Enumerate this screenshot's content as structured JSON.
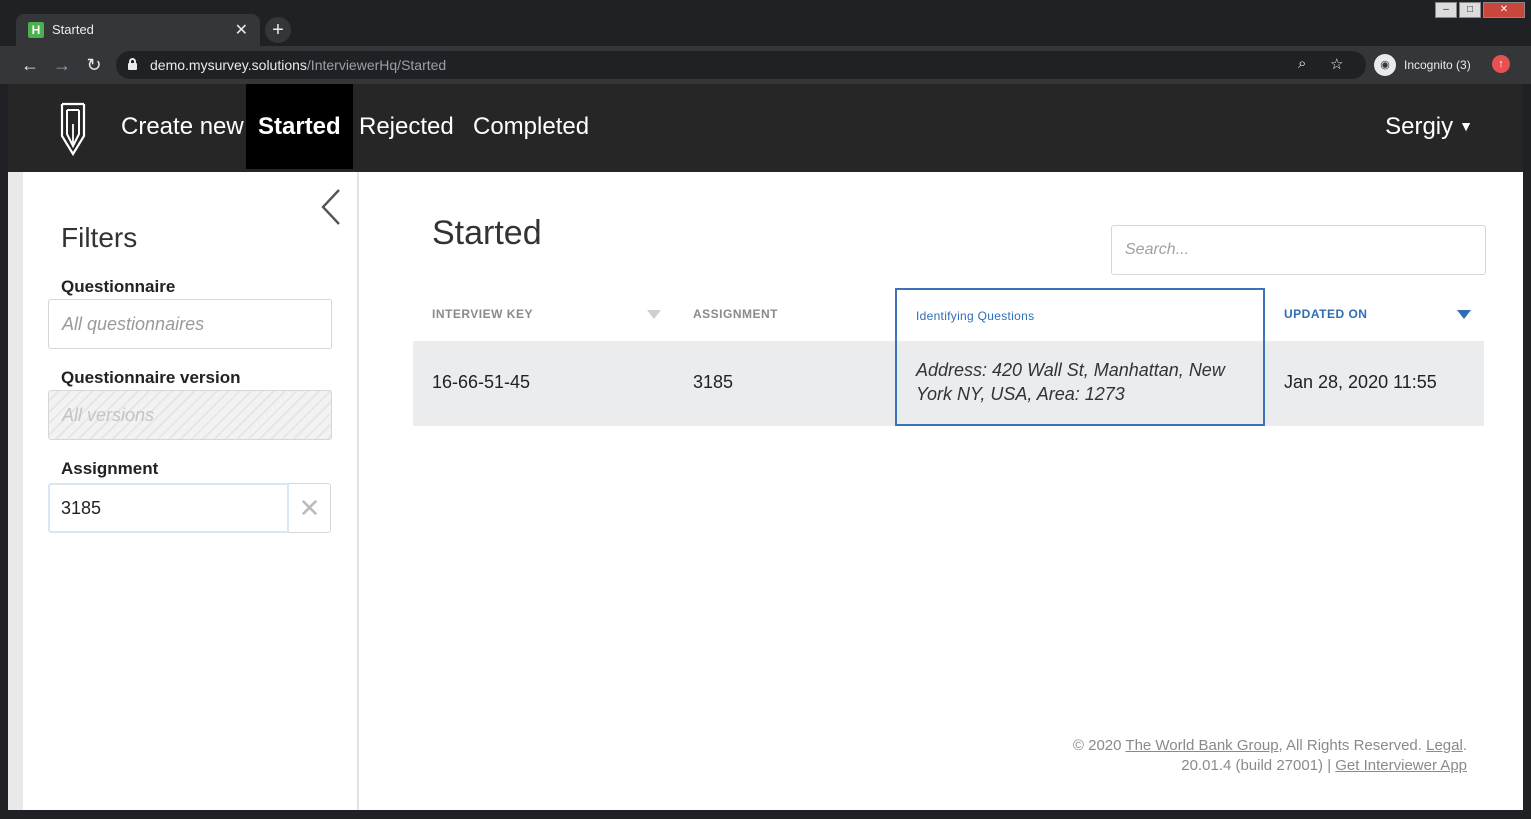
{
  "browser": {
    "tab_title": "Started",
    "tab_favicon": "H",
    "url_host": "demo.mysurvey.solutions",
    "url_path": "/InterviewerHq/Started",
    "incognito_label": "Incognito (3)"
  },
  "header": {
    "nav": [
      "Create new",
      "Started",
      "Rejected",
      "Completed"
    ],
    "active": "Started",
    "user": "Sergiy"
  },
  "sidebar": {
    "title": "Filters",
    "questionnaire_label": "Questionnaire",
    "questionnaire_placeholder": "All questionnaires",
    "version_label": "Questionnaire version",
    "version_placeholder": "All versions",
    "assignment_label": "Assignment",
    "assignment_value": "3185"
  },
  "main": {
    "title": "Started",
    "search_placeholder": "Search..."
  },
  "table": {
    "columns": [
      "INTERVIEW KEY",
      "ASSIGNMENT",
      "Identifying Questions",
      "UPDATED ON"
    ],
    "rows": [
      {
        "interview_key": "16-66-51-45",
        "assignment": "3185",
        "identifying_questions": "Address: 420 Wall St, Manhattan, New York NY, USA, Area: 1273",
        "updated_on": "Jan 28, 2020 11:55"
      }
    ]
  },
  "footer": {
    "copyright_prefix": "© 2020",
    "org_link": "The World Bank Group",
    "rights": ", All Rights Reserved.",
    "legal_link": "Legal",
    "version": "20.01.4 (build 27001) |",
    "app_link": "Get Interviewer App"
  },
  "colors": {
    "header_bg": "#262626",
    "accent": "#2f6db3",
    "row_bg": "#ebecee"
  }
}
